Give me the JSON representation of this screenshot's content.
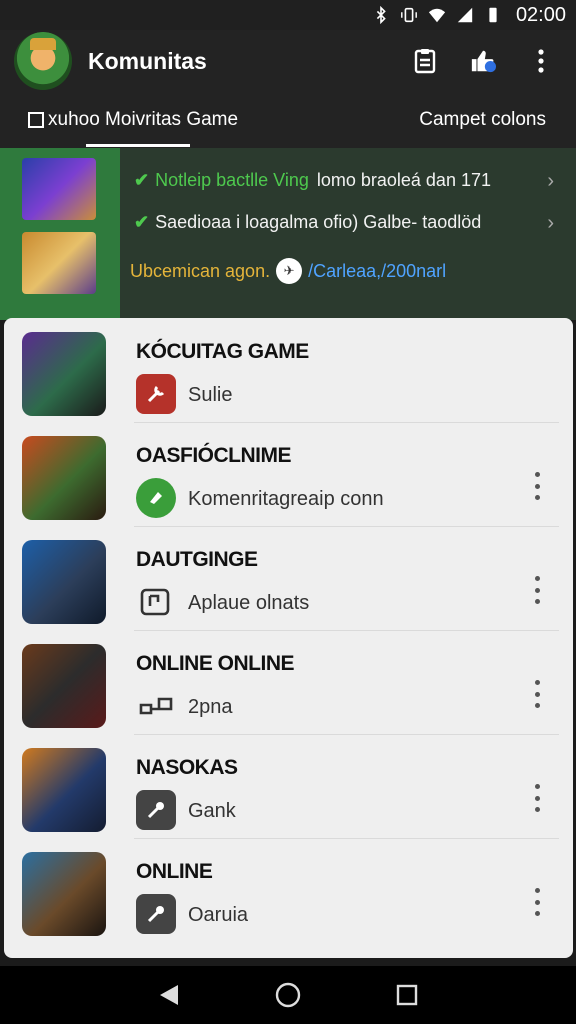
{
  "status_bar": {
    "time": "02:00"
  },
  "app_bar": {
    "title": "Komunitas"
  },
  "tabs": {
    "left_label": "xuhoo Moivritas Game",
    "right_label": "Campet colons"
  },
  "banner": {
    "notif_1": {
      "green_text": "Notleip bactlle Ving",
      "white_text": "lomo braoleá dan 171"
    },
    "notif_2": {
      "white_text": "Saedioaa i loagalma ofio) Galbe- taodlöd"
    },
    "notif_3": {
      "yellow_text": "Ubcemican agon.",
      "blue_text": "/Carleaa,/200narl"
    }
  },
  "games": [
    {
      "title": "KÓCUITAG GAME",
      "subtitle": "Sulie",
      "icon": "wrench-icon",
      "icon_bg": "#b5322a"
    },
    {
      "title": "OASFIÓCLNIME",
      "subtitle": "Komenritagreaip conn",
      "icon": "tag-icon",
      "icon_bg": "#3a9e3a"
    },
    {
      "title": "DAUTGINGE",
      "subtitle": "Aplaue olnats",
      "icon": "gamepad-icon",
      "icon_bg": "#efefef"
    },
    {
      "title": "ONLINE ONLINE",
      "subtitle": "2pna",
      "icon": "controller-icon",
      "icon_bg": "#efefef"
    },
    {
      "title": "NASOKAS",
      "subtitle": "Gank",
      "icon": "wrench-icon",
      "icon_bg": "#444444"
    },
    {
      "title": "ONLINE",
      "subtitle": "Oaruia",
      "icon": "wrench-icon",
      "icon_bg": "#444444"
    }
  ],
  "colors": {
    "accent_green": "#4ec94e",
    "banner_bg": "#2b3a2e",
    "app_bar_bg": "#232323"
  }
}
